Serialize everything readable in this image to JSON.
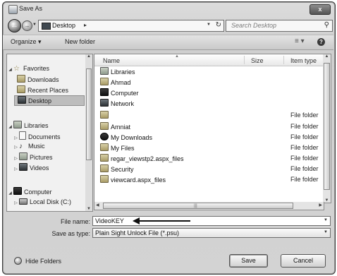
{
  "window": {
    "title": "Save As",
    "close_label": "x"
  },
  "address": {
    "location": "Desktop",
    "separator": "▸",
    "search_placeholder": "Search Desktop"
  },
  "toolbar": {
    "organize_label": "Organize ▾",
    "new_folder_label": "New folder"
  },
  "nav": {
    "favorites": "Favorites",
    "downloads": "Downloads",
    "recent_places": "Recent Places",
    "desktop": "Desktop",
    "libraries": "Libraries",
    "documents": "Documents",
    "music": "Music",
    "pictures": "Pictures",
    "videos": "Videos",
    "computer": "Computer",
    "local_disk": "Local Disk (C:)"
  },
  "columns": {
    "name": "Name",
    "size": "Size",
    "type": "Item type"
  },
  "files": [
    {
      "name": "Libraries",
      "type": ""
    },
    {
      "name": "Ahmad",
      "type": ""
    },
    {
      "name": "Computer",
      "type": ""
    },
    {
      "name": "Network",
      "type": ""
    },
    {
      "name": "",
      "type": "File folder"
    },
    {
      "name": "Amniat",
      "type": "File folder"
    },
    {
      "name": "My Downloads",
      "type": "File folder"
    },
    {
      "name": "My Files",
      "type": "File folder"
    },
    {
      "name": "regar_viewstp2.aspx_files",
      "type": "File folder"
    },
    {
      "name": "Security",
      "type": "File folder"
    },
    {
      "name": "viewcard.aspx_files",
      "type": "File folder"
    }
  ],
  "form": {
    "file_name_label": "File name:",
    "file_name_value": "VideoKEY",
    "save_type_label": "Save as type:",
    "save_type_value": "Plain Sight Unlock File (*.psu)"
  },
  "footer": {
    "hide_folders": "Hide Folders",
    "save": "Save",
    "cancel": "Cancel"
  }
}
